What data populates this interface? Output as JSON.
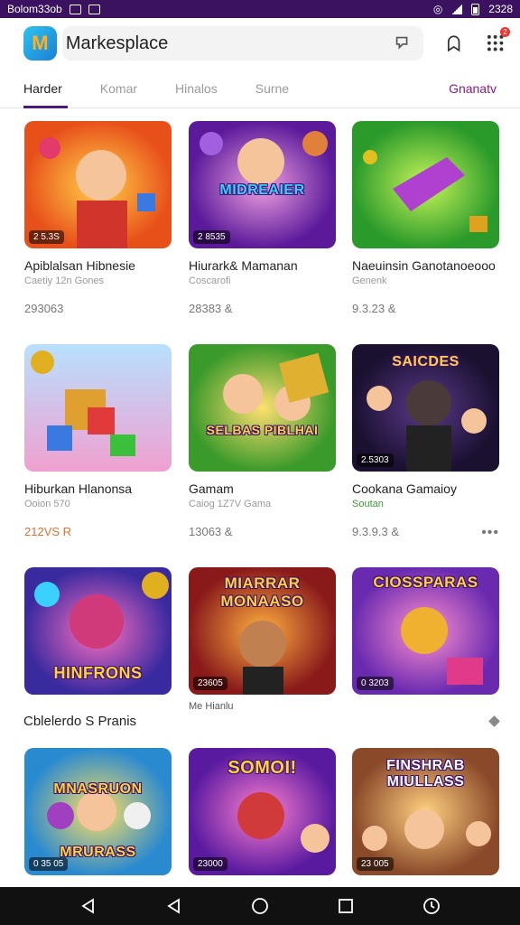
{
  "status": {
    "left_text": "Bolom33ob",
    "right_text": "2328"
  },
  "header": {
    "title": "Markesplace",
    "logo_letter": "M",
    "notification_count": "2"
  },
  "tabs": [
    {
      "label": "Harder",
      "active": true
    },
    {
      "label": "Komar"
    },
    {
      "label": "Hinalos"
    },
    {
      "label": "Surne"
    },
    {
      "label": "Gnanatv"
    }
  ],
  "cards": [
    {
      "name": "Apiblalsan Hibnesie",
      "sub": "Caetiy 12n Gones",
      "price": "293063",
      "tag": "2 5.3S",
      "art": ""
    },
    {
      "name": "Hiurark& Mamanan",
      "sub": "Coscarofi",
      "price": "28383 &",
      "tag": "2 8535",
      "art": "MIDREAIER"
    },
    {
      "name": "Naeuinsin Ganotanoeooo",
      "sub": "Genenk",
      "price": "9.3.23 &",
      "tag": "",
      "art": ""
    },
    {
      "name": "Hiburkan Hlanonsa",
      "sub": "Ooion 570",
      "price": "212VS R",
      "tag": "",
      "art": ""
    },
    {
      "name": "Gamam",
      "sub": "Caiog 1Z7V Gama",
      "price": "13063 &",
      "tag": "",
      "art": "SELBAS PIBLHAI"
    },
    {
      "name": "Cookana Gamaioy",
      "sub": "Soutan",
      "price": "9.3.9.3 &",
      "tag": "2.5303",
      "art": "SAICDES"
    },
    {
      "name": "",
      "sub": "",
      "price": "",
      "tag": "",
      "art": "HINFRONS"
    },
    {
      "name": "",
      "sub": "",
      "price": "",
      "tag": "23605",
      "art": "MIARRAR MONAASO"
    },
    {
      "name": "",
      "sub": "",
      "price": "",
      "tag": "0 3203",
      "art": "CIOSSPARAS"
    },
    {
      "name": "",
      "sub": "",
      "price": "",
      "tag": "0 35 05",
      "art": "MNASRUON MRURASS"
    },
    {
      "name": "",
      "sub": "",
      "price": "",
      "tag": "23000",
      "art": "SOMOI!"
    },
    {
      "name": "",
      "sub": "",
      "price": "",
      "tag": "23 005",
      "art": "FINSHRAB MIULLASS"
    }
  ],
  "caption": "Me Hianlu",
  "section_title": "Cblelerdo S Pranis",
  "more_label": "•••",
  "colors": {
    "accent": "#4b1a7a",
    "status_bar": "#3a1260",
    "tab_right": "#8a1a8a"
  }
}
